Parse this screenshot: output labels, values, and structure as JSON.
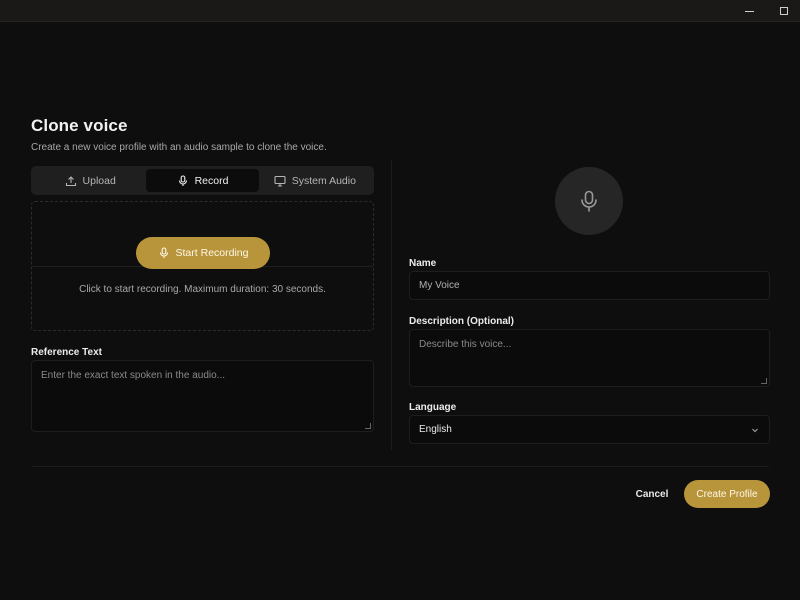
{
  "dialog": {
    "title": "Clone voice",
    "subtitle": "Create a new voice profile with an audio sample to clone the voice."
  },
  "tabs": [
    {
      "label": "Upload",
      "icon": "upload-icon",
      "active": false
    },
    {
      "label": "Record",
      "icon": "mic-icon",
      "active": true
    },
    {
      "label": "System Audio",
      "icon": "monitor-icon",
      "active": false
    }
  ],
  "record": {
    "button_label": "Start Recording",
    "hint": "Click to start recording. Maximum duration: 30 seconds."
  },
  "reference": {
    "label": "Reference Text",
    "placeholder": "Enter the exact text spoken in the audio..."
  },
  "form": {
    "name_label": "Name",
    "name_placeholder": "My Voice",
    "description_label": "Description (Optional)",
    "description_placeholder": "Describe this voice...",
    "language_label": "Language",
    "language_value": "English"
  },
  "actions": {
    "cancel_label": "Cancel",
    "create_label": "Create Profile"
  },
  "colors": {
    "accent": "#b8953b",
    "background": "#0e0e0e"
  }
}
